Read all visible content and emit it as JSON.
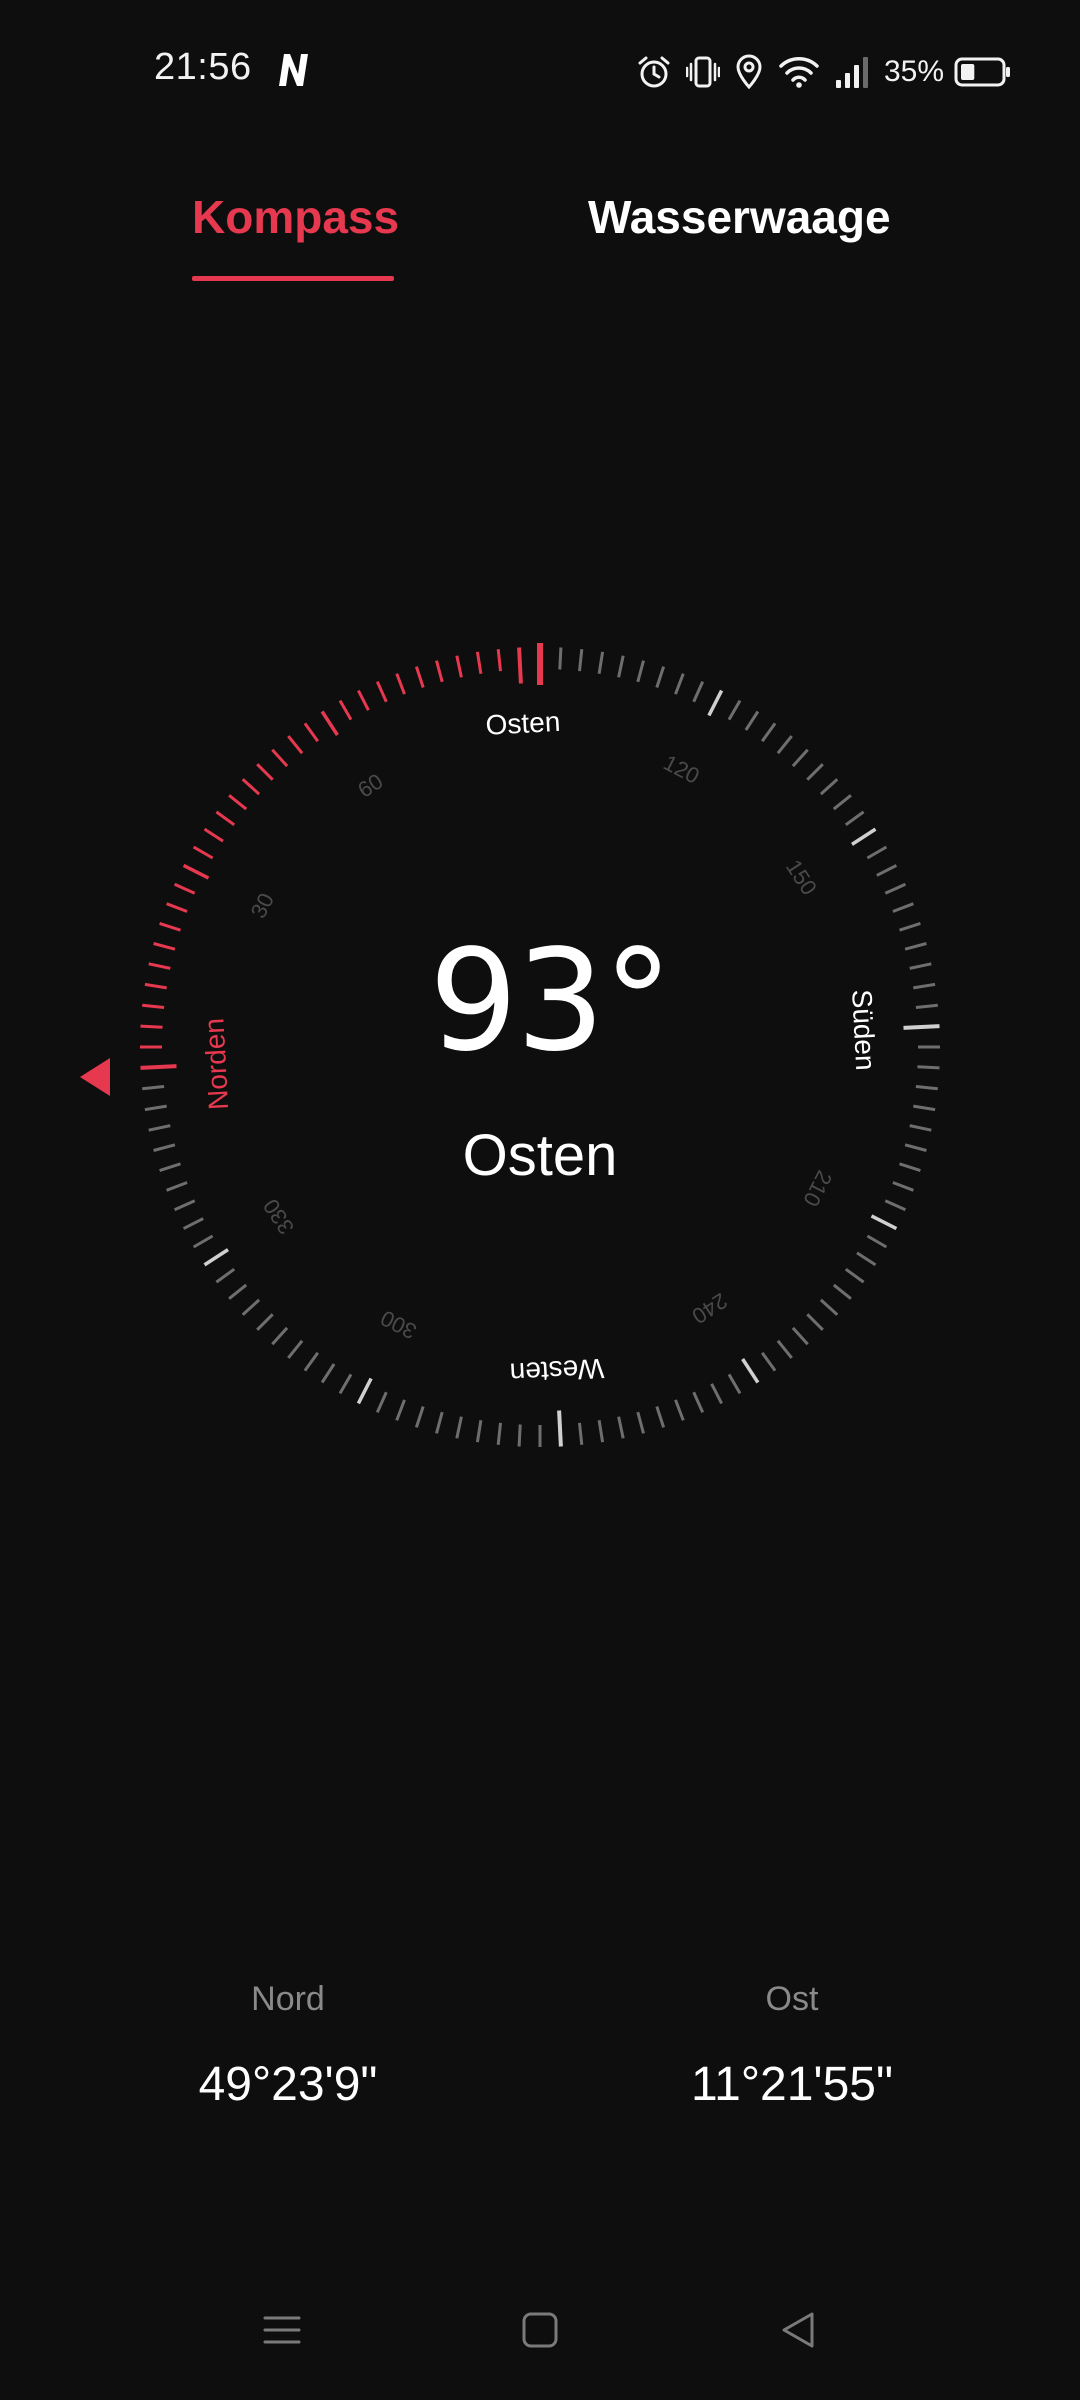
{
  "status_bar": {
    "time": "21:56",
    "app_icon": "n-app-icon",
    "icons": [
      "alarm-icon",
      "vibrate-icon",
      "location-icon",
      "wifi-icon",
      "signal-icon",
      "battery-icon"
    ],
    "battery_percent": "35%",
    "battery_level": 0.35
  },
  "tabs": [
    {
      "label": "Kompass",
      "active": true
    },
    {
      "label": "Wasserwaage",
      "active": false
    }
  ],
  "colors": {
    "accent": "#e6384e",
    "background": "#0e0e0f",
    "tick": "#6e6e6e",
    "tick_major": "#d0d0d0",
    "muted_text": "#8a8a8a"
  },
  "compass": {
    "heading_deg": 93,
    "degree_display": "93°",
    "direction": "Osten",
    "cardinal_labels": {
      "north": "Norden",
      "east": "Osten",
      "south": "Süden",
      "west": "Westen"
    },
    "tick_labels": [
      "30",
      "60",
      "120",
      "150",
      "210",
      "240",
      "300",
      "330"
    ],
    "north_indicator": "triangle-pointer-icon"
  },
  "coordinates": {
    "lat_label": "Nord",
    "lat_value": "49°23'9\"",
    "lon_label": "Ost",
    "lon_value": "11°21'55\""
  },
  "nav_bar": {
    "icons": [
      "menu-icon",
      "home-icon",
      "back-icon"
    ]
  }
}
